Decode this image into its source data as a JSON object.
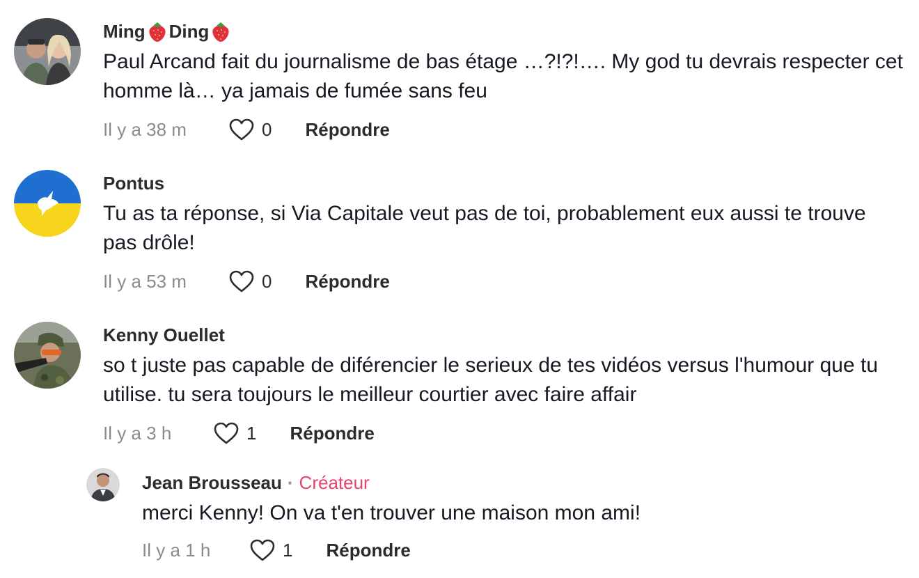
{
  "comments": [
    {
      "author": "Ming",
      "author_suffix": "Ding",
      "text": "Paul Arcand fait du journalisme de bas étage …?!?!…. My god tu devrais respecter cet homme là… ya jamais de fumée sans feu",
      "time": "Il y a 38 m",
      "likes": "0",
      "reply_label": "Répondre"
    },
    {
      "author": "Pontus",
      "text": "Tu as ta réponse, si Via Capitale veut pas de toi, probablement eux aussi te trouve pas drôle!",
      "time": "Il y a 53 m",
      "likes": "0",
      "reply_label": "Répondre"
    },
    {
      "author": "Kenny Ouellet",
      "text": "so t juste pas capable de diférencier le serieux de tes vidéos versus l'humour que tu utilise. tu sera toujours le meilleur courtier avec faire affair",
      "time": "Il y a 3 h",
      "likes": "1",
      "reply_label": "Répondre"
    }
  ],
  "reply": {
    "author": "Jean Brousseau",
    "separator": "·",
    "badge": "Créateur",
    "text": "merci Kenny! On va t'en trouver une maison mon ami!",
    "time": "Il y a 1 h",
    "likes": "1",
    "reply_label": "Répondre"
  },
  "colors": {
    "creator_badge": "#e4456b",
    "muted": "#8a8b91",
    "text": "#161823"
  },
  "icons": {
    "like": "heart-outline-icon",
    "emoji": "strawberry-icon"
  }
}
